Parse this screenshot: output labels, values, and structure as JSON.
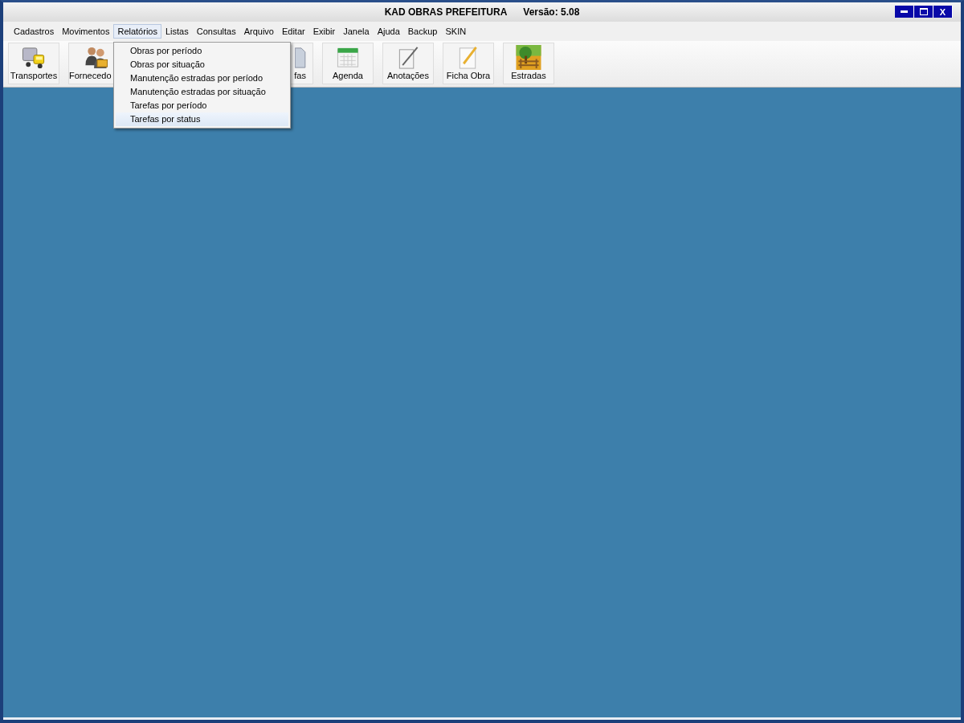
{
  "window": {
    "title": "KAD OBRAS PREFEITURA",
    "version": "Versão: 5.08",
    "controls": [
      {
        "kind": "minimize"
      },
      {
        "kind": "maximize"
      },
      {
        "kind": "close",
        "label": "X"
      }
    ]
  },
  "menu_bar": [
    {
      "label": "Cadastros",
      "selected": false
    },
    {
      "label": "Movimentos",
      "selected": false
    },
    {
      "label": "Relatórios",
      "selected": true
    },
    {
      "label": "Listas",
      "selected": false
    },
    {
      "label": "Consultas",
      "selected": false
    },
    {
      "label": "Arquivo",
      "selected": false
    },
    {
      "label": "Editar",
      "selected": false
    },
    {
      "label": "Exibir",
      "selected": false
    },
    {
      "label": "Janela",
      "selected": false
    },
    {
      "label": "Ajuda",
      "selected": false
    },
    {
      "label": "Backup",
      "selected": false
    },
    {
      "label": "SKIN",
      "selected": false
    }
  ],
  "toolbar": [
    {
      "label": "Transportes"
    },
    {
      "label": "Fornecedo"
    },
    {
      "label": "fas"
    },
    {
      "label": "Agenda"
    },
    {
      "label": "Anotações"
    },
    {
      "label": "Ficha Obra"
    },
    {
      "label": "Estradas"
    }
  ],
  "dropdown": [
    {
      "label": "Obras por período",
      "selected": false
    },
    {
      "label": "Obras por situação",
      "selected": false
    },
    {
      "label": "Manutenção estradas por período",
      "selected": false
    },
    {
      "label": "Manutenção estradas por situação",
      "selected": false
    },
    {
      "label": "Tarefas por período",
      "selected": false
    },
    {
      "label": "Tarefas por status",
      "selected": true
    }
  ]
}
